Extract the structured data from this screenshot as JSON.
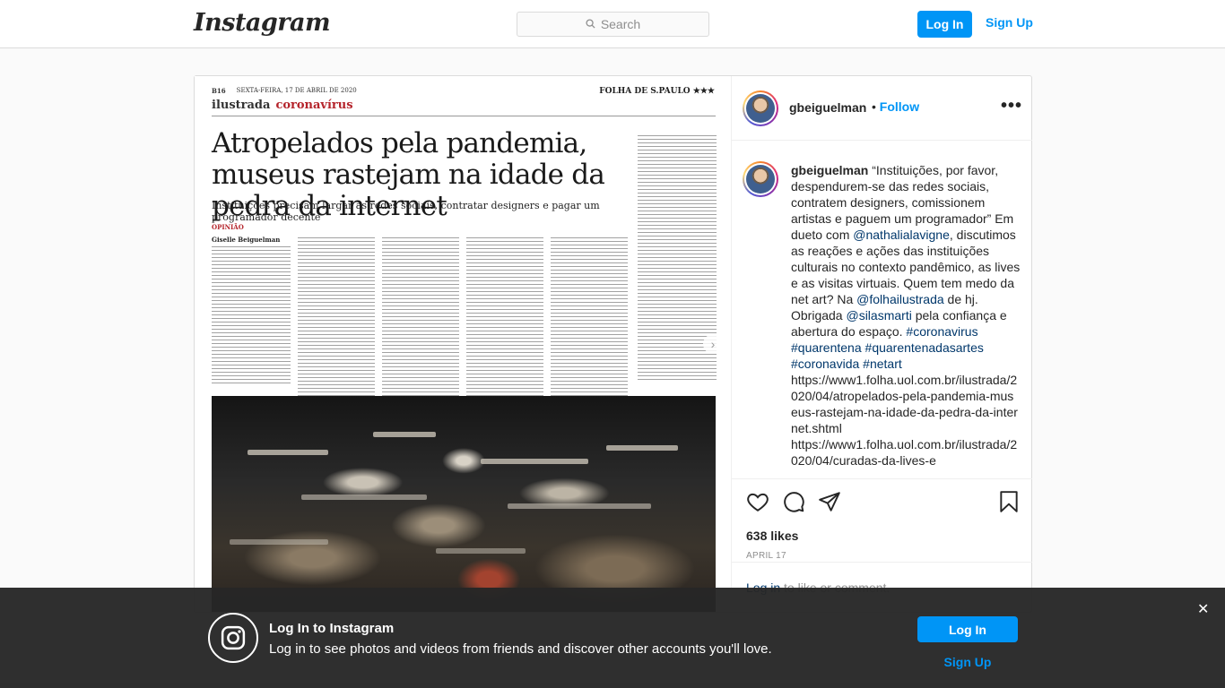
{
  "topbar": {
    "logo_text": "Instagram",
    "search_placeholder": "Search",
    "login_label": "Log In",
    "signup_label": "Sign Up"
  },
  "newspaper": {
    "page_meta": "B16",
    "date_line": "SEXTA-FEIRA, 17 DE ABRIL DE 2020",
    "brand": "FOLHA DE S.PAULO ★★★",
    "section": "ilustrada",
    "section_tag": "coronavírus",
    "headline": "Atropelados pela pandemia, museus rastejam na idade da pedra da internet",
    "subheadline": "Instituições precisam largar as redes sociais, contratar designers e pagar um programador decente",
    "opinion_label": "OPINIÃO",
    "author": "Giselle Beiguelman"
  },
  "post": {
    "username": "gbeiguelman",
    "follow_separator": "•",
    "follow_label": "Follow",
    "more_label": "•••",
    "caption": {
      "username": "gbeiguelman",
      "text_1": " “Instituições, por favor, despendurem-se das redes sociais, contratem designers, comissionem artistas e paguem um programador” Em dueto com ",
      "mention_1": "@nathalialavigne",
      "text_2": ", discutimos as reações e ações das instituições culturais no contexto pandêmico, as lives e as visitas virtuais. Quem tem medo da net art? Na ",
      "mention_2": "@folhailustrada",
      "text_3": " de hj. Obrigada ",
      "mention_3": "@silasmarti",
      "text_4": " pela confiança e abertura do espaço. ",
      "hashtag_1": "#coronavirus",
      "hashtag_2": "#quarentena",
      "hashtag_3": "#quarentenadasartes",
      "hashtag_4": "#coronavida",
      "hashtag_5": "#netart",
      "url_1": "https://www1.folha.uol.com.br/ilustrada/2020/04/atropelados-pela-pandemia-museus-rastejam-na-idade-da-pedra-da-internet.shtml",
      "url_2": "https://www1.folha.uol.com.br/ilustrada/2020/04/curadas-da-lives-e"
    },
    "likes": "638 likes",
    "date": "APRIL 17",
    "comment_login": "Log in",
    "comment_rest": " to like or comment."
  },
  "banner": {
    "title": "Log In to Instagram",
    "text": "Log in to see photos and videos from friends and discover other accounts you'll love.",
    "login_label": "Log In",
    "signup_label": "Sign Up",
    "close_label": "✕"
  },
  "colors": {
    "accent": "#0095f6",
    "link": "#00376b",
    "banner_bg": "#262626"
  },
  "icons": [
    "search-icon",
    "heart-icon",
    "comment-icon",
    "share-icon",
    "bookmark-icon",
    "instagram-icon",
    "close-icon",
    "chevron-right-icon",
    "more-icon"
  ]
}
